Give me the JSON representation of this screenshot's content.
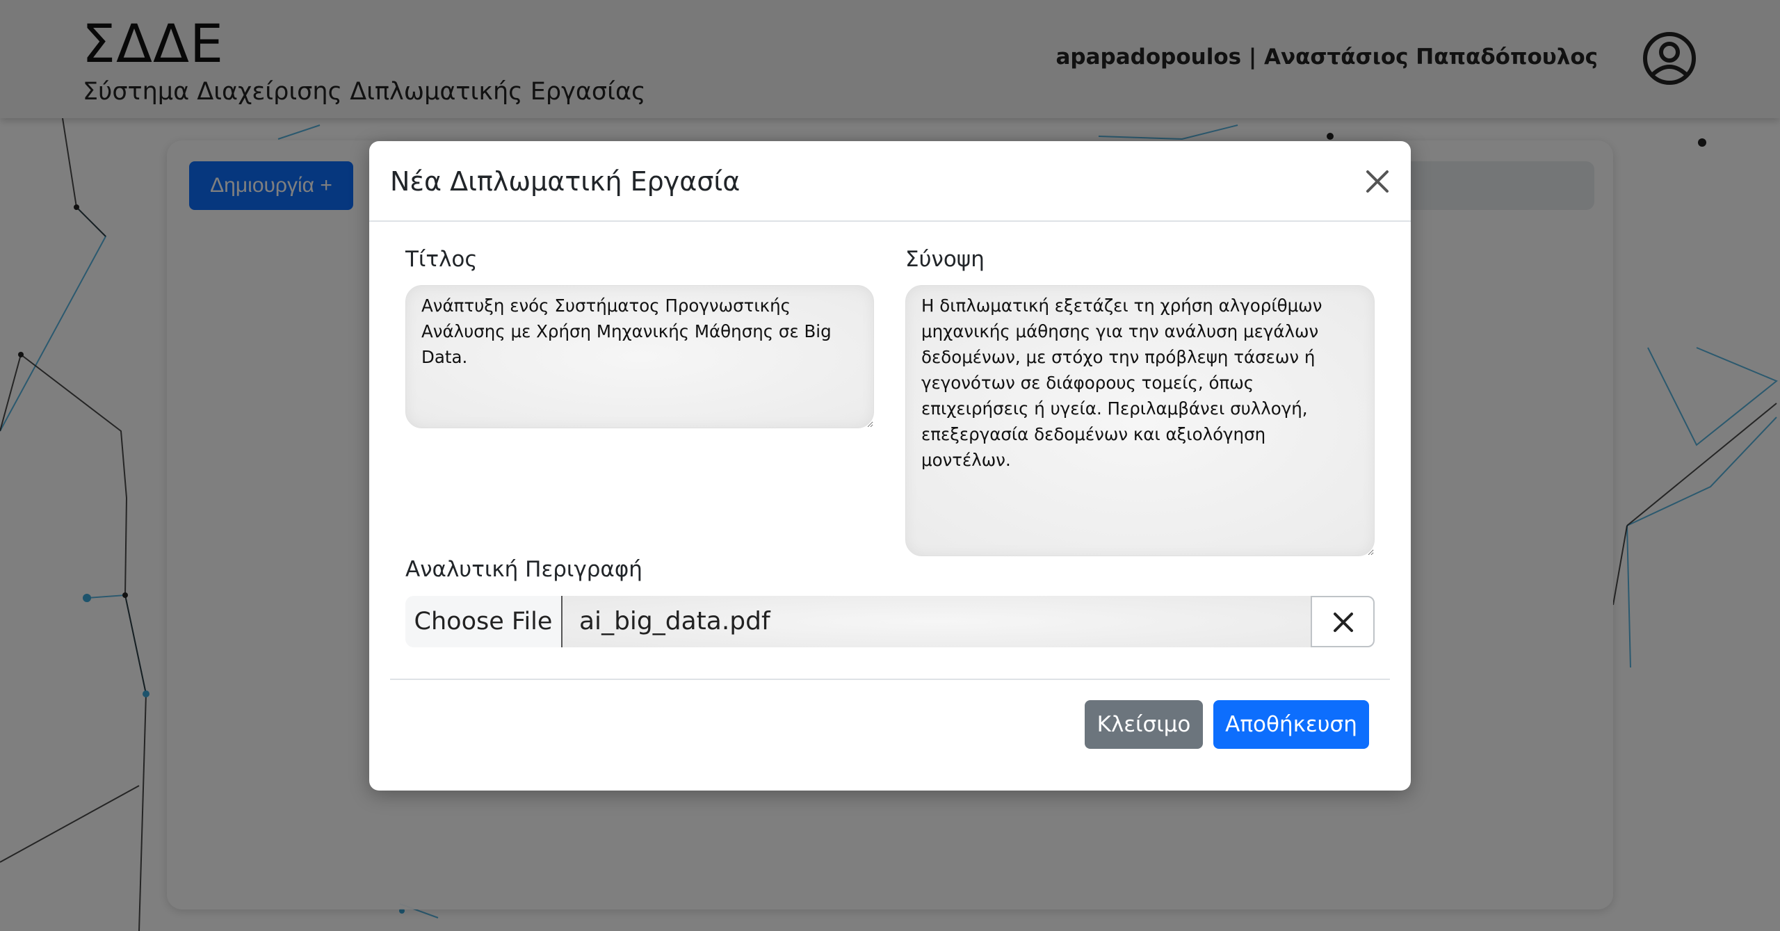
{
  "header": {
    "app_title": "ΣΔΔΕ",
    "app_subtitle": "Σύστημα Διαχείρισης Διπλωματικής Εργασίας",
    "user_label": "apapadopoulos | Αναστάσιος Παπαδόπουλος",
    "avatar_icon": "user-circle-icon"
  },
  "main": {
    "create_button_label": "Δημιουργία +"
  },
  "modal": {
    "title": "Νέα Διπλωματική Εργασία",
    "close_icon": "close-icon",
    "title_field": {
      "label": "Τίτλος",
      "value": "Ανάπτυξη ενός Συστήματος Προγνωστικής Ανάλυσης με Χρήση Μηχανικής Μάθησης σε Big Data."
    },
    "summary_field": {
      "label": "Σύνοψη",
      "value": "Η διπλωματική εξετάζει τη χρήση αλγορίθμων μηχανικής μάθησης για την ανάλυση μεγάλων δεδομένων, με στόχο την πρόβλεψη τάσεων ή γεγονότων σε διάφορους τομείς, όπως επιχειρήσεις ή υγεία. Περιλαμβάνει συλλογή, επεξεργασία δεδομένων και αξιολόγηση μοντέλων."
    },
    "description_field": {
      "label": "Αναλυτική Περιγραφή",
      "choose_file_label": "Choose File",
      "file_name": "ai_big_data.pdf",
      "clear_icon": "x-icon"
    },
    "footer": {
      "close_label": "Κλείσιμο",
      "save_label": "Αποθήκευση"
    }
  },
  "colors": {
    "primary": "#0d6efd",
    "secondary": "#6c757d",
    "backdrop": "rgba(0,0,0,0.5)",
    "network_blue": "#3aa6d8",
    "network_dark": "#222222"
  }
}
